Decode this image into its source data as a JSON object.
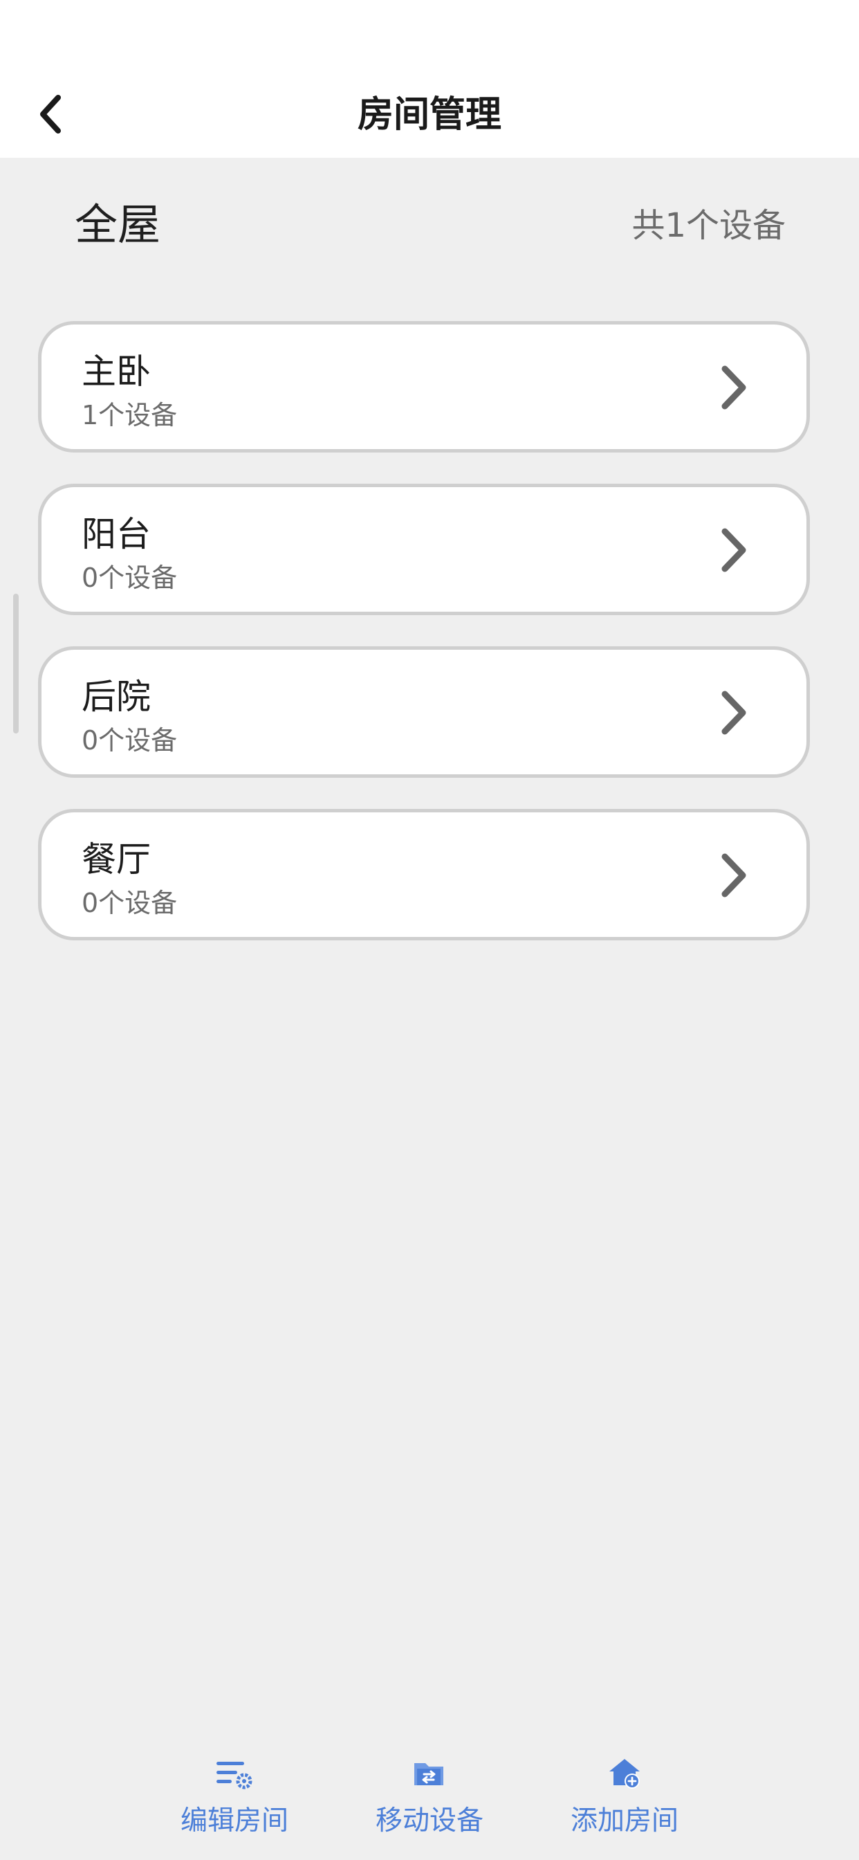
{
  "header": {
    "title": "房间管理"
  },
  "summary": {
    "title": "全屋",
    "device_count": "共1个设备"
  },
  "rooms": [
    {
      "name": "主卧",
      "count": "1个设备"
    },
    {
      "name": "阳台",
      "count": "0个设备"
    },
    {
      "name": "后院",
      "count": "0个设备"
    },
    {
      "name": "餐厅",
      "count": "0个设备"
    }
  ],
  "bottom_bar": {
    "edit_rooms": "编辑房间",
    "move_devices": "移动设备",
    "add_room": "添加房间"
  },
  "colors": {
    "accent": "#4c7fd8",
    "background": "#efefef",
    "card_border": "#cfcfcf"
  },
  "icons": {
    "back": "chevron-left-icon",
    "room_arrow": "chevron-right-icon",
    "edit_rooms": "list-gear-icon",
    "move_devices": "folder-move-icon",
    "add_room": "house-plus-icon"
  }
}
